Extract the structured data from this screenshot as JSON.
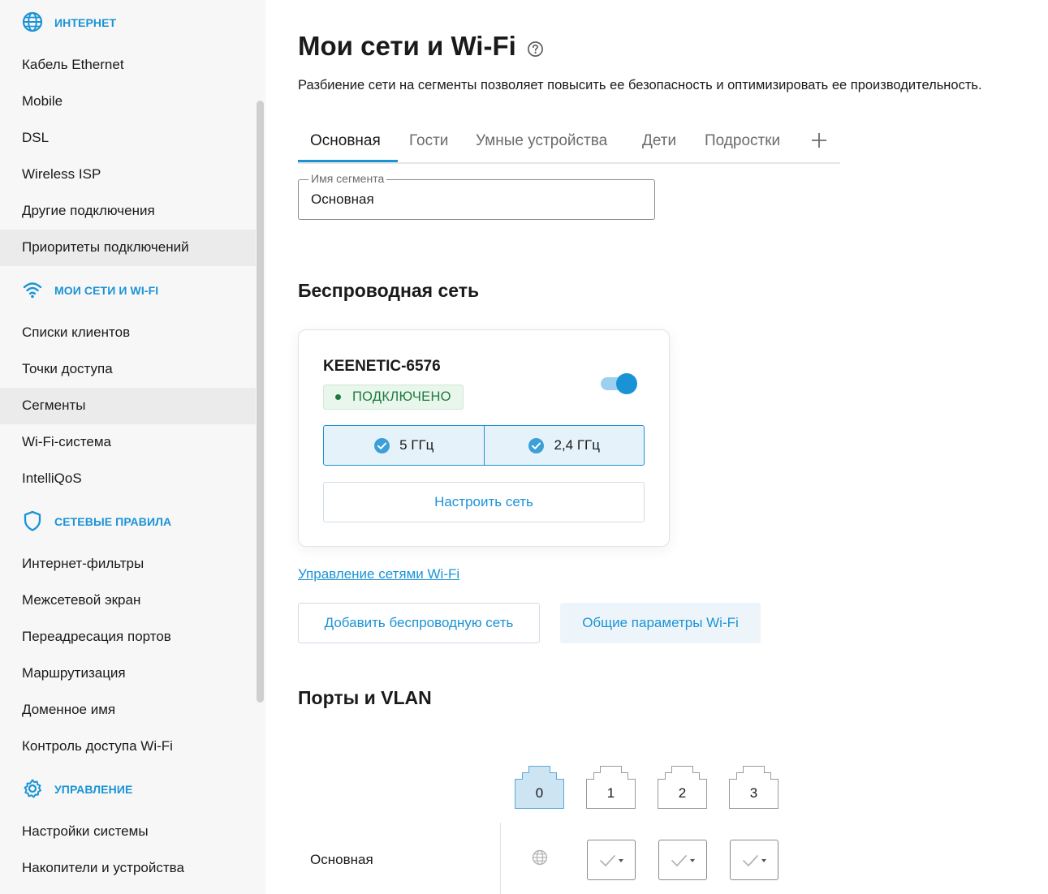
{
  "sidebar": {
    "sections": [
      {
        "label": "ИНТЕРНЕТ",
        "icon": "globe-icon",
        "items": [
          {
            "label": "Кабель Ethernet",
            "active": false
          },
          {
            "label": "Mobile",
            "active": false
          },
          {
            "label": "DSL",
            "active": false
          },
          {
            "label": "Wireless ISP",
            "active": false
          },
          {
            "label": "Другие подключения",
            "active": false
          },
          {
            "label": "Приоритеты подключений",
            "active": true
          }
        ]
      },
      {
        "label": "МОИ СЕТИ И WI-FI",
        "icon": "wifi-icon",
        "items": [
          {
            "label": "Списки клиентов",
            "active": false
          },
          {
            "label": "Точки доступа",
            "active": false
          },
          {
            "label": "Сегменты",
            "active": true
          },
          {
            "label": "Wi-Fi-система",
            "active": false
          },
          {
            "label": "IntelliQoS",
            "active": false
          }
        ]
      },
      {
        "label": "СЕТЕВЫЕ ПРАВИЛА",
        "icon": "shield-icon",
        "items": [
          {
            "label": "Интернет-фильтры",
            "active": false
          },
          {
            "label": "Межсетевой экран",
            "active": false
          },
          {
            "label": "Переадресация портов",
            "active": false
          },
          {
            "label": "Маршрутизация",
            "active": false
          },
          {
            "label": "Доменное имя",
            "active": false
          },
          {
            "label": "Контроль доступа Wi-Fi",
            "active": false
          }
        ]
      },
      {
        "label": "УПРАВЛЕНИЕ",
        "icon": "gear-icon",
        "items": [
          {
            "label": "Настройки системы",
            "active": false
          },
          {
            "label": "Накопители и устройства",
            "active": false
          }
        ]
      }
    ]
  },
  "page": {
    "title": "Мои сети и Wi-Fi",
    "subtitle": "Разбиение сети на сегменты позволяет повысить ее безопасность и оптимизировать ее производительность."
  },
  "tabs": [
    {
      "label": "Основная",
      "active": true
    },
    {
      "label": "Гости",
      "active": false
    },
    {
      "label": "Умные устройства",
      "active": false
    },
    {
      "label": "Дети",
      "active": false
    },
    {
      "label": "Подростки",
      "active": false
    }
  ],
  "segment_field": {
    "label": "Имя сегмента",
    "value": "Основная"
  },
  "wireless": {
    "heading": "Беспроводная сеть",
    "ssid": "KEENETIC-6576",
    "enabled": true,
    "status": "ПОДКЛЮЧЕНО",
    "bands": [
      "5 ГГц",
      "2,4 ГГц"
    ],
    "configure_label": "Настроить сеть",
    "manage_link": "Управление сетями Wi-Fi",
    "add_button": "Добавить беспроводную сеть",
    "general_button": "Общие параметры Wi-Fi"
  },
  "ports": {
    "heading": "Порты и VLAN",
    "port_numbers": [
      "0",
      "1",
      "2",
      "3"
    ],
    "active_port": "0",
    "row_label": "Основная"
  },
  "colors": {
    "accent": "#1a93d6",
    "status_green": "#1d7a3f",
    "status_bg": "#e9f6ec",
    "sidebar_bg": "#f7f7f7"
  }
}
